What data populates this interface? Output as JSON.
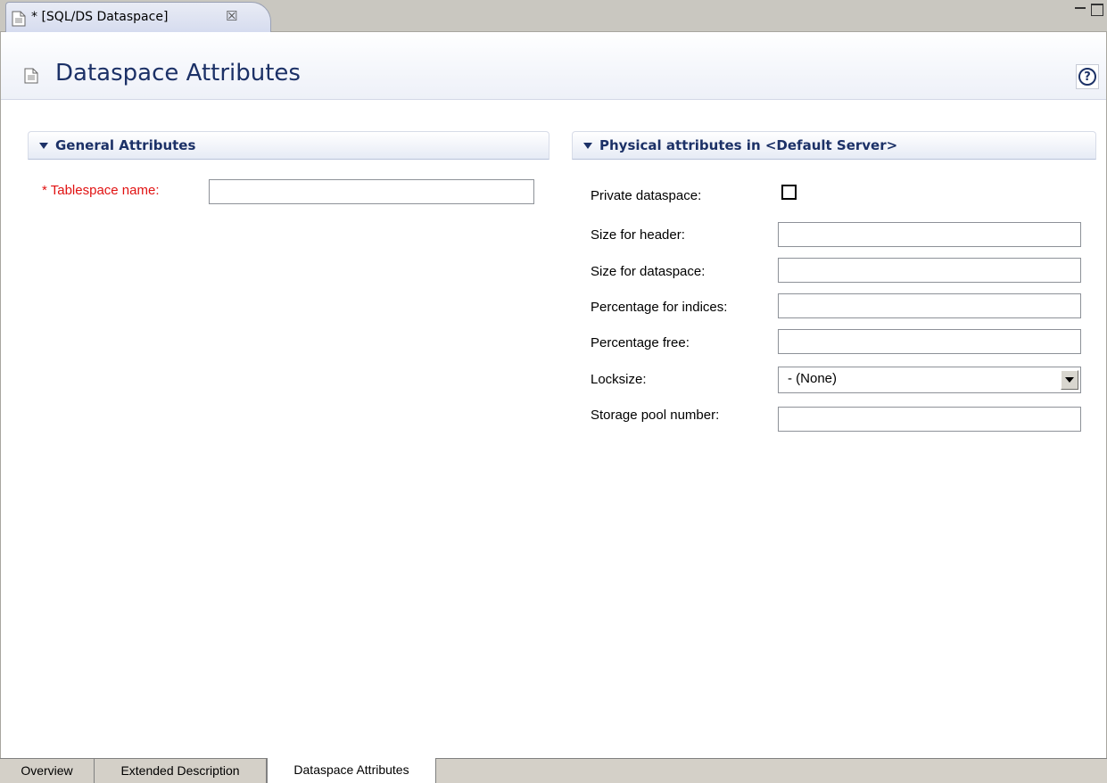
{
  "editor_tab": {
    "label": "* [SQL/DS Dataspace]",
    "close_icon": "close-icon"
  },
  "header": {
    "title": "Dataspace Attributes",
    "help_label": "?"
  },
  "general": {
    "title": "General Attributes",
    "tablespace": {
      "required_mark": "*",
      "label": "Tablespace name:",
      "value": ""
    }
  },
  "physical": {
    "title": "Physical attributes in <Default Server>",
    "private": {
      "label": "Private dataspace:",
      "checked": false
    },
    "size_header": {
      "label": "Size for header:",
      "value": ""
    },
    "size_dataspace": {
      "label": "Size for dataspace:",
      "value": ""
    },
    "pct_indices": {
      "label": "Percentage for indices:",
      "value": ""
    },
    "pct_free": {
      "label": "Percentage free:",
      "value": ""
    },
    "locksize": {
      "label": "Locksize:",
      "value": "- (None)"
    },
    "storage_pool": {
      "label": "Storage pool number:",
      "value": ""
    }
  },
  "bottom_tabs": [
    {
      "label": "Overview"
    },
    {
      "label": "Extended Description"
    },
    {
      "label": "Dataspace Attributes"
    }
  ],
  "colors": {
    "title": "#1c3167",
    "required": "#e11212"
  }
}
